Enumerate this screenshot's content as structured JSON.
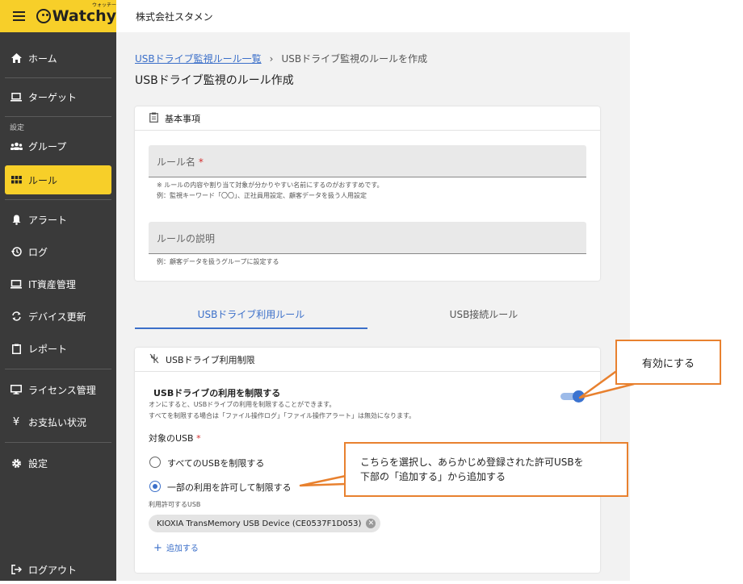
{
  "app": {
    "logo_text": "Watchy",
    "logo_kana": "ウォッチー",
    "company": "株式会社スタメン"
  },
  "sidebar": {
    "items": [
      {
        "label": "ホーム",
        "icon": "home-icon"
      },
      {
        "label": "ターゲット",
        "icon": "laptop-icon"
      },
      {
        "label": "グループ",
        "icon": "group-icon"
      },
      {
        "label": "ルール",
        "icon": "grid-icon"
      },
      {
        "label": "アラート",
        "icon": "bell-icon"
      },
      {
        "label": "ログ",
        "icon": "history-icon"
      },
      {
        "label": "IT資産管理",
        "icon": "monitor-icon"
      },
      {
        "label": "デバイス更新",
        "icon": "sync-icon"
      },
      {
        "label": "レポート",
        "icon": "clipboard-icon"
      },
      {
        "label": "ライセンス管理",
        "icon": "desktop-icon"
      },
      {
        "label": "お支払い状況",
        "icon": "yen-icon"
      },
      {
        "label": "設定",
        "icon": "gear-icon"
      }
    ],
    "section_label": "設定",
    "logout_label": "ログアウト"
  },
  "breadcrumb": {
    "parent": "USBドライブ監視ルール一覧",
    "separator": "›",
    "current": "USBドライブ監視のルールを作成"
  },
  "page_title": "USBドライブ監視のルール作成",
  "basic": {
    "header": "基本事項",
    "rule_name_label": "ルール名",
    "required_mark": "*",
    "rule_name_hint1": "※ ルールの内容や割り当て対象が分かりやすい名前にするのがおすすめです。",
    "rule_name_hint2": "例：監視キーワード「〇〇」、正社員用設定、顧客データを扱う人用設定",
    "description_label": "ルールの説明",
    "description_hint": "例：顧客データを扱うグループに設定する"
  },
  "tabs": [
    {
      "label": "USBドライブ利用ルール",
      "active": true
    },
    {
      "label": "USB接続ルール",
      "active": false
    }
  ],
  "usb_restrict": {
    "header": "USBドライブ利用制限",
    "title": "USBドライブの利用を制限する",
    "desc1": "オンにすると、USBドライブの利用を制限することができます。",
    "desc2": "すべてを制限する場合は「ファイル操作ログ」「ファイル操作アラート」は無効になります。",
    "toggle_on": true,
    "target_label": "対象のUSB",
    "required_mark": "*",
    "option_all": "すべてのUSBを制限する",
    "option_partial": "一部の利用を許可して制限する",
    "selected_option": "partial",
    "allowed_label": "利用許可するUSB",
    "allowed_devices": [
      "KIOXIA TransMemory USB Device (CE0537F1D053)"
    ],
    "add_label": "追加する"
  },
  "callouts": {
    "enable": "有効にする",
    "select_line1": "こちらを選択し、あらかじめ登録された許可USBを",
    "select_line2": "下部の「追加する」から追加する"
  },
  "colors": {
    "brand_yellow": "#f7cf29",
    "sidebar_bg": "#3a3a3a",
    "accent_blue": "#3b6fc9",
    "callout_orange": "#e8812f",
    "required_red": "#d32f2f"
  }
}
